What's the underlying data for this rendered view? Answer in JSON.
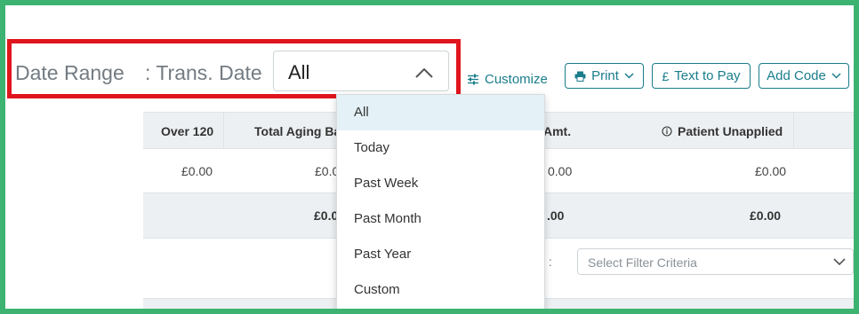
{
  "date_range": {
    "label": "Date Range",
    "field": ": Trans. Date",
    "selected": "All"
  },
  "toolbar": {
    "customize": "Customize",
    "print": "Print",
    "text_to_pay": "Text to Pay",
    "add_code": "Add Code",
    "currency_symbol": "£"
  },
  "table": {
    "headers": [
      "Over 120",
      "Total Aging Ba",
      "Amt.",
      "Patient Unapplied"
    ],
    "row1": [
      "£0.00",
      "£0.0",
      "0.00",
      "£0.00"
    ],
    "row2": [
      "£0.0",
      ".00",
      "£0.00"
    ]
  },
  "filter": {
    "label": "y :",
    "placeholder": "Select Filter Criteria"
  },
  "dropdown": {
    "options": [
      "All",
      "Today",
      "Past Week",
      "Past Month",
      "Past Year",
      "Custom"
    ],
    "selected_index": 0
  },
  "colors": {
    "accent": "#1a7d8c",
    "highlight_border": "#e0151d",
    "frame_border": "#3cb371",
    "selected_bg": "#e4f1f7"
  }
}
